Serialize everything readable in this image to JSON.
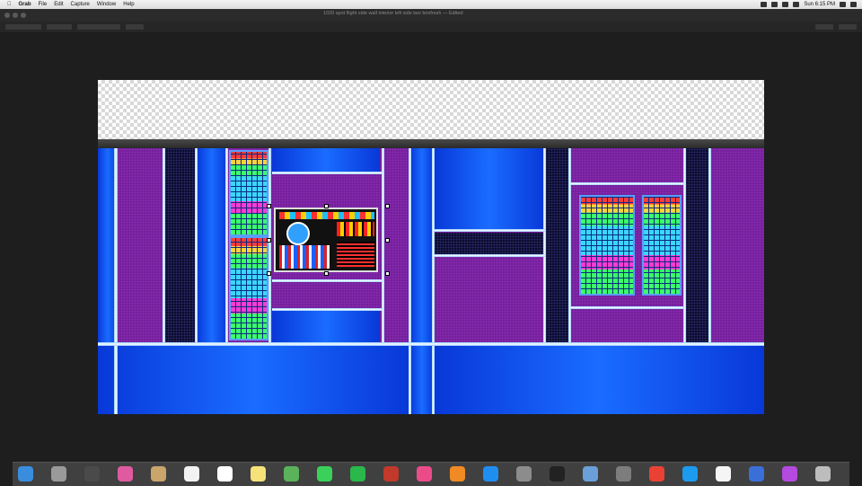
{
  "menubar": {
    "app": "Grab",
    "items": [
      "File",
      "Edit",
      "Capture",
      "Window",
      "Help"
    ],
    "clock": "Sun 6:15 PM"
  },
  "window": {
    "title": "1020 spot flight side wall interior left side two brisfresh — Edited"
  },
  "dock": {
    "icons": [
      "finder-icon",
      "launchpad-icon",
      "mission-control-icon",
      "photos-icon",
      "contacts-icon",
      "calendar-icon",
      "reminders-icon",
      "notes-icon",
      "maps-icon",
      "messages-icon",
      "facetime-icon",
      "photo-booth-icon",
      "itunes-icon",
      "ibooks-icon",
      "app-store-icon",
      "system-preferences-icon",
      "terminal-icon",
      "preview-icon",
      "grab-icon",
      "chrome-icon",
      "safari-icon",
      "textedit-icon",
      "xcode-icon",
      "utility-icon",
      "trash-icon"
    ]
  },
  "colors": {
    "wall_purple": "#7a1fa0",
    "wall_blue": "#1a6cff",
    "rail": "#cfe6ff"
  }
}
